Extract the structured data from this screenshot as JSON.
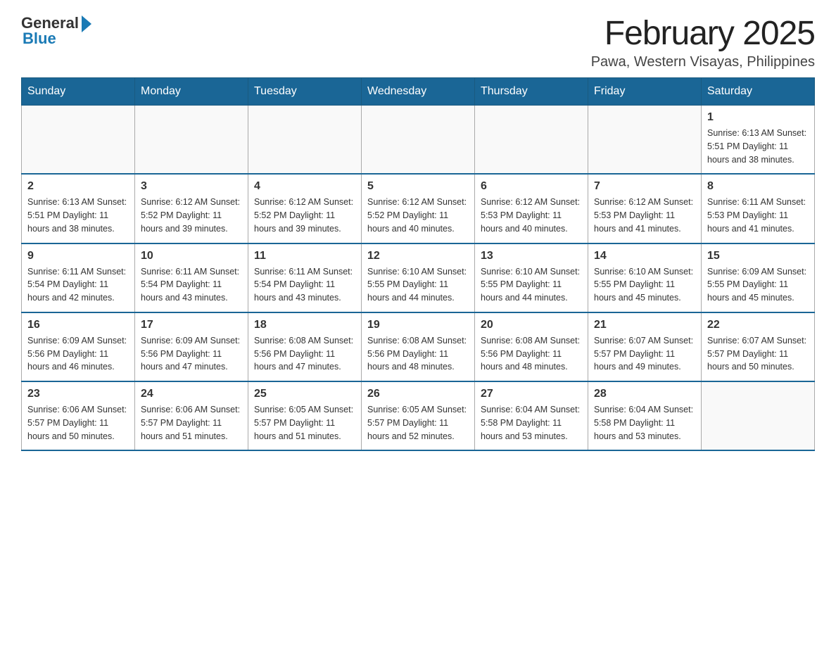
{
  "header": {
    "logo_general": "General",
    "logo_blue": "Blue",
    "month_title": "February 2025",
    "subtitle": "Pawa, Western Visayas, Philippines"
  },
  "days_of_week": [
    "Sunday",
    "Monday",
    "Tuesday",
    "Wednesday",
    "Thursday",
    "Friday",
    "Saturday"
  ],
  "weeks": [
    [
      {
        "day": "",
        "info": ""
      },
      {
        "day": "",
        "info": ""
      },
      {
        "day": "",
        "info": ""
      },
      {
        "day": "",
        "info": ""
      },
      {
        "day": "",
        "info": ""
      },
      {
        "day": "",
        "info": ""
      },
      {
        "day": "1",
        "info": "Sunrise: 6:13 AM\nSunset: 5:51 PM\nDaylight: 11 hours and 38 minutes."
      }
    ],
    [
      {
        "day": "2",
        "info": "Sunrise: 6:13 AM\nSunset: 5:51 PM\nDaylight: 11 hours and 38 minutes."
      },
      {
        "day": "3",
        "info": "Sunrise: 6:12 AM\nSunset: 5:52 PM\nDaylight: 11 hours and 39 minutes."
      },
      {
        "day": "4",
        "info": "Sunrise: 6:12 AM\nSunset: 5:52 PM\nDaylight: 11 hours and 39 minutes."
      },
      {
        "day": "5",
        "info": "Sunrise: 6:12 AM\nSunset: 5:52 PM\nDaylight: 11 hours and 40 minutes."
      },
      {
        "day": "6",
        "info": "Sunrise: 6:12 AM\nSunset: 5:53 PM\nDaylight: 11 hours and 40 minutes."
      },
      {
        "day": "7",
        "info": "Sunrise: 6:12 AM\nSunset: 5:53 PM\nDaylight: 11 hours and 41 minutes."
      },
      {
        "day": "8",
        "info": "Sunrise: 6:11 AM\nSunset: 5:53 PM\nDaylight: 11 hours and 41 minutes."
      }
    ],
    [
      {
        "day": "9",
        "info": "Sunrise: 6:11 AM\nSunset: 5:54 PM\nDaylight: 11 hours and 42 minutes."
      },
      {
        "day": "10",
        "info": "Sunrise: 6:11 AM\nSunset: 5:54 PM\nDaylight: 11 hours and 43 minutes."
      },
      {
        "day": "11",
        "info": "Sunrise: 6:11 AM\nSunset: 5:54 PM\nDaylight: 11 hours and 43 minutes."
      },
      {
        "day": "12",
        "info": "Sunrise: 6:10 AM\nSunset: 5:55 PM\nDaylight: 11 hours and 44 minutes."
      },
      {
        "day": "13",
        "info": "Sunrise: 6:10 AM\nSunset: 5:55 PM\nDaylight: 11 hours and 44 minutes."
      },
      {
        "day": "14",
        "info": "Sunrise: 6:10 AM\nSunset: 5:55 PM\nDaylight: 11 hours and 45 minutes."
      },
      {
        "day": "15",
        "info": "Sunrise: 6:09 AM\nSunset: 5:55 PM\nDaylight: 11 hours and 45 minutes."
      }
    ],
    [
      {
        "day": "16",
        "info": "Sunrise: 6:09 AM\nSunset: 5:56 PM\nDaylight: 11 hours and 46 minutes."
      },
      {
        "day": "17",
        "info": "Sunrise: 6:09 AM\nSunset: 5:56 PM\nDaylight: 11 hours and 47 minutes."
      },
      {
        "day": "18",
        "info": "Sunrise: 6:08 AM\nSunset: 5:56 PM\nDaylight: 11 hours and 47 minutes."
      },
      {
        "day": "19",
        "info": "Sunrise: 6:08 AM\nSunset: 5:56 PM\nDaylight: 11 hours and 48 minutes."
      },
      {
        "day": "20",
        "info": "Sunrise: 6:08 AM\nSunset: 5:56 PM\nDaylight: 11 hours and 48 minutes."
      },
      {
        "day": "21",
        "info": "Sunrise: 6:07 AM\nSunset: 5:57 PM\nDaylight: 11 hours and 49 minutes."
      },
      {
        "day": "22",
        "info": "Sunrise: 6:07 AM\nSunset: 5:57 PM\nDaylight: 11 hours and 50 minutes."
      }
    ],
    [
      {
        "day": "23",
        "info": "Sunrise: 6:06 AM\nSunset: 5:57 PM\nDaylight: 11 hours and 50 minutes."
      },
      {
        "day": "24",
        "info": "Sunrise: 6:06 AM\nSunset: 5:57 PM\nDaylight: 11 hours and 51 minutes."
      },
      {
        "day": "25",
        "info": "Sunrise: 6:05 AM\nSunset: 5:57 PM\nDaylight: 11 hours and 51 minutes."
      },
      {
        "day": "26",
        "info": "Sunrise: 6:05 AM\nSunset: 5:57 PM\nDaylight: 11 hours and 52 minutes."
      },
      {
        "day": "27",
        "info": "Sunrise: 6:04 AM\nSunset: 5:58 PM\nDaylight: 11 hours and 53 minutes."
      },
      {
        "day": "28",
        "info": "Sunrise: 6:04 AM\nSunset: 5:58 PM\nDaylight: 11 hours and 53 minutes."
      },
      {
        "day": "",
        "info": ""
      }
    ]
  ]
}
